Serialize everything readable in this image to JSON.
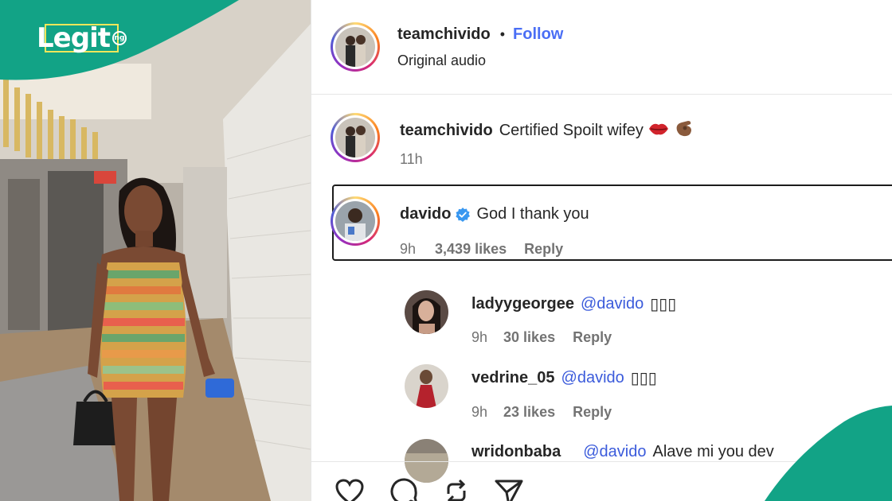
{
  "brand": {
    "logo_text": "Legit",
    "logo_badge": "ng"
  },
  "post_header": {
    "username": "teamchivido",
    "separator": "•",
    "follow_label": "Follow",
    "subtitle": "Original audio"
  },
  "caption": {
    "username": "teamchivido",
    "text": "Certified Spoilt wifey",
    "emojis": [
      "lips-emoji",
      "pinching-hand-emoji"
    ],
    "time": "11h"
  },
  "comments": [
    {
      "username": "davido",
      "verified": true,
      "text": "God I thank you",
      "time": "9h",
      "likes": "3,439 likes",
      "reply_label": "Reply",
      "highlighted": true
    },
    {
      "username": "ladyygeorgee",
      "mention": "@davido",
      "text": "▯▯▯",
      "time": "9h",
      "likes": "30 likes",
      "reply_label": "Reply"
    },
    {
      "username": "vedrine_05",
      "mention": "@davido",
      "text": "▯▯▯",
      "time": "9h",
      "likes": "23 likes",
      "reply_label": "Reply"
    },
    {
      "username": "wridonbaba",
      "mention": "@davido",
      "text": "Alave mi you dev"
    }
  ],
  "actions": [
    "heart-icon",
    "comment-icon",
    "repost-icon",
    "share-icon"
  ],
  "colors": {
    "brand_green": "#12a386",
    "link_blue": "#4a6ef5",
    "mention_blue": "#3b5bdb",
    "verified_blue": "#3897f0"
  }
}
